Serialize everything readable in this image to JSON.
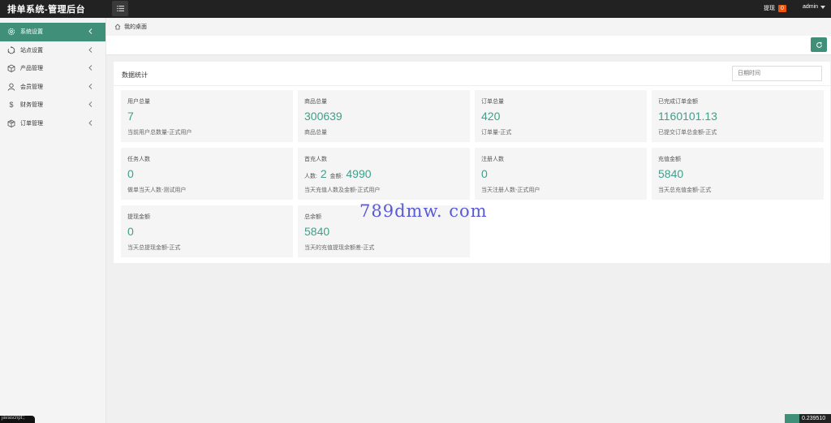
{
  "topbar": {
    "brand": "排单系统-管理后台",
    "withdraw_label": "提现",
    "withdraw_count": "0",
    "user": "admin"
  },
  "sidebar": {
    "items": [
      {
        "label": "系统设置",
        "icon": "gear-icon",
        "active": true
      },
      {
        "label": "站点设置",
        "icon": "cycle-icon",
        "active": false
      },
      {
        "label": "产品管理",
        "icon": "box-icon",
        "active": false
      },
      {
        "label": "会员管理",
        "icon": "user-icon",
        "active": false
      },
      {
        "label": "财务管理",
        "icon": "dollar-icon",
        "active": false
      },
      {
        "label": "订单管理",
        "icon": "cube-icon",
        "active": false
      }
    ]
  },
  "breadcrumb": {
    "home": "我的桌面"
  },
  "panel": {
    "title": "数据统计",
    "date_placeholder": "日期时间"
  },
  "cards": [
    {
      "label": "用户总量",
      "value": "7",
      "sub": "当前用户总数量-正式用户"
    },
    {
      "label": "商品总量",
      "value": "300639",
      "sub": "商品总量"
    },
    {
      "label": "订单总量",
      "value": "420",
      "sub": "订单量-正式"
    },
    {
      "label": "已完成订单金额",
      "value": "1160101.13",
      "sub": "已提交订单总金额-正式"
    },
    {
      "label": "任务人数",
      "value": "0",
      "sub": "做单当天人数-测试用户"
    },
    {
      "label": "首充人数",
      "people_label": "人数:",
      "people": "2",
      "amount_label": "金额:",
      "amount": "4990",
      "sub": "当天充值人数及金额-正式用户"
    },
    {
      "label": "注册人数",
      "value": "0",
      "sub": "当天注册人数-正式用户"
    },
    {
      "label": "充值金额",
      "value": "5840",
      "sub": "当天总充值金额-正式"
    },
    {
      "label": "提现金额",
      "value": "0",
      "sub": "当天总提现金额-正式"
    },
    {
      "label": "总余额",
      "value": "5840",
      "sub": "当天的充值提现余额差-正式"
    }
  ],
  "watermark": "789dmw. com",
  "statusbar": {
    "left": "javascript:;",
    "right": "0.239510"
  },
  "colors": {
    "accent": "#3f8f79",
    "value": "#3f9f8a",
    "badge": "#e8560f",
    "topbar": "#222222"
  }
}
